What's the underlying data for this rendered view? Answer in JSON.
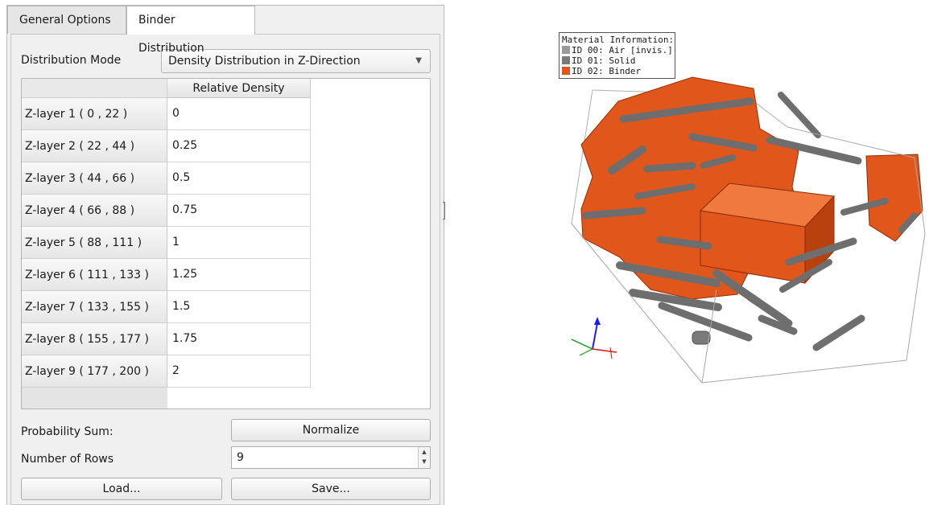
{
  "tabs": [
    {
      "label": "General Options",
      "active": false
    },
    {
      "label": "Binder Distribution",
      "active": true
    }
  ],
  "distribution": {
    "label": "Distribution Mode",
    "selected": "Density Distribution in Z-Direction"
  },
  "table": {
    "column_header": "Relative Density",
    "rows": [
      {
        "label": "Z-layer 1 ( 0 , 22 )",
        "value": "0"
      },
      {
        "label": "Z-layer 2 ( 22 , 44 )",
        "value": "0.25"
      },
      {
        "label": "Z-layer 3 ( 44 , 66 )",
        "value": "0.5"
      },
      {
        "label": "Z-layer 4 ( 66 , 88 )",
        "value": "0.75"
      },
      {
        "label": "Z-layer 5 ( 88 , 111 )",
        "value": "1"
      },
      {
        "label": "Z-layer 6 ( 111 , 133 )",
        "value": "1.25"
      },
      {
        "label": "Z-layer 7 ( 133 , 155 )",
        "value": "1.5"
      },
      {
        "label": "Z-layer 8 ( 155 , 177 )",
        "value": "1.75"
      },
      {
        "label": "Z-layer 9 ( 177 , 200 )",
        "value": "2"
      }
    ]
  },
  "probability": {
    "label": "Probability Sum:",
    "normalize_label": "Normalize"
  },
  "rows_field": {
    "label": "Number of Rows",
    "value": "9"
  },
  "buttons": {
    "load": "Load...",
    "save": "Save..."
  },
  "legend": {
    "title": "Material Information:",
    "items": [
      {
        "text": "ID 00: Air [invis.]",
        "color": "#9a9a9a"
      },
      {
        "text": "ID 01: Solid",
        "color": "#808080"
      },
      {
        "text": "ID 02: Binder",
        "color": "#e0561b"
      }
    ]
  },
  "colors": {
    "binder": "#e0561b",
    "solid": "#7a7a7a"
  },
  "icons": [
    "chevron-down-icon",
    "spin-arrows-icon",
    "axes-triad-icon"
  ]
}
